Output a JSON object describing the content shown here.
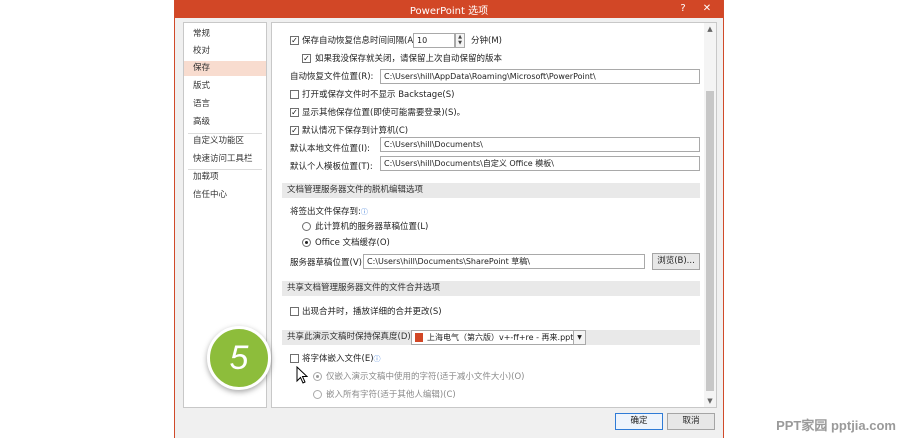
{
  "window": {
    "title": "PowerPoint 选项",
    "help": "?",
    "close": "✕"
  },
  "nav": {
    "items": [
      "常规",
      "校对",
      "保存",
      "版式",
      "语言",
      "高级",
      "自定义功能区",
      "快速访问工具栏",
      "加载项",
      "信任中心"
    ],
    "active_index": 2
  },
  "save": {
    "autorecover_label": "保存自动恢复信息时间间隔(A)",
    "autorecover_checked": true,
    "autorecover_minutes": "10",
    "minutes_label": "分钟(M)",
    "keep_last_label": "如果我没保存就关闭，请保留上次自动保留的版本",
    "keep_last_checked": true,
    "autorecover_path_label": "自动恢复文件位置(R):",
    "autorecover_path": "C:\\Users\\hill\\AppData\\Roaming\\Microsoft\\PowerPoint\\",
    "no_backstage_label": "打开或保存文件时不显示 Backstage(S)",
    "no_backstage_checked": false,
    "show_more_places_label": "显示其他保存位置(即使可能需要登录)(S)。",
    "show_more_places_checked": true,
    "default_computer_label": "默认情况下保存到计算机(C)",
    "default_computer_checked": true,
    "default_local_label": "默认本地文件位置(I):",
    "default_local_path": "C:\\Users\\hill\\Documents\\",
    "personal_template_label": "默认个人模板位置(T):",
    "personal_template_path": "C:\\Users\\hill\\Documents\\自定义 Office 模板\\"
  },
  "offline": {
    "header": "文档管理服务器文件的脱机编辑选项",
    "checkout_label": "将签出文件保存到:",
    "info_icon": "ⓘ",
    "option_server": "此计算机的服务器草稿位置(L)",
    "option_cache": "Office 文档缓存(O)",
    "selected": "cache",
    "drafts_label": "服务器草稿位置(V):",
    "drafts_path": "C:\\Users\\hill\\Documents\\SharePoint 草稿\\",
    "browse_label": "浏览(B)..."
  },
  "merge": {
    "header": "共享文档管理服务器文件的文件合并选项",
    "show_changes_label": "出现合并时，播放详细的合并更改(S)",
    "show_changes_checked": false
  },
  "fidelity": {
    "header_label": "共享此演示文稿时保持保真度(D):",
    "file": "上海电气（第六版）v+-ff+re - 再来.pptx",
    "embed_fonts_label": "将字体嵌入文件(E)",
    "embed_fonts_checked": false,
    "embed_used_label": "仅嵌入演示文稿中使用的字符(适于减小文件大小)(O)",
    "embed_all_label": "嵌入所有字符(适于其他人编辑)(C)",
    "embed_selected": "used"
  },
  "footer": {
    "ok_label": "确定",
    "cancel_label": "取消"
  },
  "overlay": {
    "step_number": "5",
    "watermark": "PPT家园 pptjia.com"
  },
  "colors": {
    "titlebar": "#d24726",
    "nav_active": "#f8dccf",
    "badge": "#8dbd3b"
  }
}
